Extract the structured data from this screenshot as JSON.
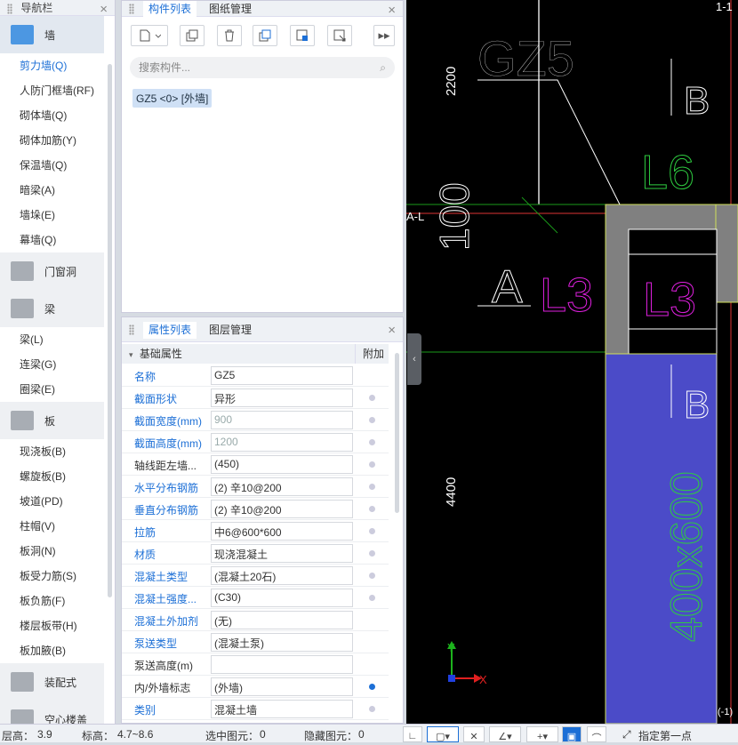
{
  "nav": {
    "title": "导航栏",
    "close": "×",
    "sections": [
      {
        "cat": "墙",
        "icon": "wall-icon",
        "color": "#3c8ee0",
        "items": [
          "剪力墙(Q)",
          "人防门框墙(RF)",
          "砌体墙(Q)",
          "砌体加筋(Y)",
          "保温墙(Q)",
          "暗梁(A)",
          "墙垛(E)",
          "幕墙(Q)"
        ]
      },
      {
        "cat": "门窗洞",
        "icon": "door-window-icon",
        "color": "#8a9099",
        "items": []
      },
      {
        "cat": "梁",
        "icon": "beam-icon",
        "color": "#8a9099",
        "items": [
          "梁(L)",
          "连梁(G)",
          "圈梁(E)"
        ]
      },
      {
        "cat": "板",
        "icon": "slab-icon",
        "color": "#8a9099",
        "items": [
          "现浇板(B)",
          "螺旋板(B)",
          "坡道(PD)",
          "柱帽(V)",
          "板洞(N)",
          "板受力筋(S)",
          "板负筋(F)",
          "楼层板带(H)",
          "板加腋(B)"
        ]
      },
      {
        "cat": "装配式",
        "icon": "prefab-icon",
        "color": "#8a9099",
        "items": []
      },
      {
        "cat": "空心楼盖",
        "icon": "hollow-slab-icon",
        "color": "#8a9099",
        "items": []
      }
    ]
  },
  "component_panel": {
    "tabs": [
      "构件列表",
      "图纸管理"
    ],
    "close": "×",
    "search_placeholder": "搜索构件...",
    "selected_component": "GZ5 <0> [外墙]",
    "toolbar_icons": [
      "new-icon",
      "dropdown-icon",
      "copy-icon",
      "delete-icon",
      "layer-copy-icon",
      "floor-copy-icon",
      "export-icon",
      "more-icon"
    ]
  },
  "property_panel": {
    "tabs": [
      "属性列表",
      "图层管理"
    ],
    "close": "×",
    "section": "基础属性",
    "extra_header": "附加",
    "rows": [
      {
        "k": "名称",
        "v": "GZ5",
        "blue": true,
        "dot": ""
      },
      {
        "k": "截面形状",
        "v": "异形",
        "blue": true,
        "dot": "grey"
      },
      {
        "k": "截面宽度(mm)",
        "v": "900",
        "blue": true,
        "dot": "grey",
        "grey": true
      },
      {
        "k": "截面高度(mm)",
        "v": "1200",
        "blue": true,
        "dot": "grey",
        "grey": true
      },
      {
        "k": "轴线距左墙...",
        "v": "(450)",
        "blue": false,
        "dot": "grey"
      },
      {
        "k": "水平分布钢筋",
        "v": "(2) ⾟10@200",
        "blue": true,
        "dot": "grey"
      },
      {
        "k": "垂直分布钢筋",
        "v": "(2) ⾟10@200",
        "blue": true,
        "dot": "grey"
      },
      {
        "k": "拉筋",
        "v": "中6@600*600",
        "blue": true,
        "dot": "grey"
      },
      {
        "k": "材质",
        "v": "现浇混凝土",
        "blue": true,
        "dot": "grey"
      },
      {
        "k": "混凝土类型",
        "v": "(混凝土20石)",
        "blue": true,
        "dot": "grey"
      },
      {
        "k": "混凝土强度...",
        "v": "(C30)",
        "blue": true,
        "dot": "grey"
      },
      {
        "k": "混凝土外加剂",
        "v": "(无)",
        "blue": true,
        "dot": ""
      },
      {
        "k": "泵送类型",
        "v": "(混凝土泵)",
        "blue": true,
        "dot": ""
      },
      {
        "k": "泵送高度(m)",
        "v": "",
        "blue": false,
        "dot": ""
      },
      {
        "k": "内/外墙标志",
        "v": "(外墙)",
        "blue": false,
        "dot": "blue"
      },
      {
        "k": "类别",
        "v": "混凝土墙",
        "blue": true,
        "dot": "grey"
      }
    ]
  },
  "cad": {
    "labels": {
      "gz5": "GZ5",
      "l6": "L6",
      "l3_left": "L3",
      "l3_right": "L3",
      "b_top": "B",
      "b_mid": "B",
      "a": "A",
      "axis_a": "A-L",
      "axis_11": "1-1",
      "dim_100": "100",
      "dim_2200": "2200",
      "dim_4400": "4400",
      "dim_400x600": "400x600",
      "coord_x": "X",
      "coord_y": "Y",
      "edge_tag": "(-1)"
    }
  },
  "status": {
    "layer_height_label": "层高：",
    "layer_height": "3.9",
    "elevation_label": "标高：",
    "elevation": "4.7~8.6",
    "selected_label": "选中图元：",
    "selected": "0",
    "hidden_label": "隐藏图元：",
    "hidden": "0",
    "snap_first_point": "指定第一点"
  }
}
